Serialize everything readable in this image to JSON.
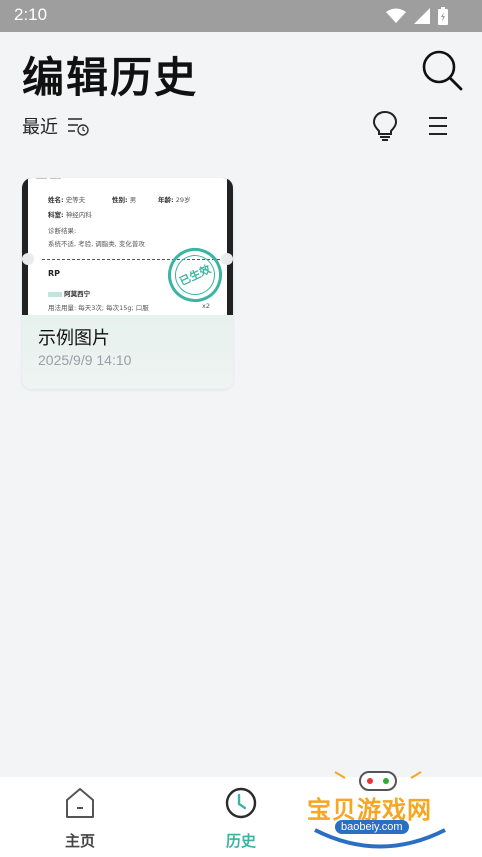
{
  "status_bar": {
    "time": "2:10",
    "icons": [
      "wifi-icon",
      "signal-icon",
      "battery-icon"
    ]
  },
  "header": {
    "title": "编辑历史"
  },
  "toolbar": {
    "sort_label": "最近"
  },
  "cards": [
    {
      "title": "示例图片",
      "time": "2025/9/9 14:10",
      "thumb": {
        "lines": [
          "姓名:",
          "史等夫",
          "性别:",
          "男",
          "年龄:",
          "29岁",
          "科室:",
          "神经内科",
          "诊断结果:",
          "系统不适, 考验, 调脂类, 变化普攻",
          "RP",
          "阿莫西宁",
          "用法用量: 每天3次; 每次15g; 口服",
          "x2"
        ],
        "stamp": "已生效"
      }
    }
  ],
  "bottom_nav": {
    "items": [
      {
        "label": "主页",
        "active": false
      },
      {
        "label": "历史",
        "active": true
      }
    ]
  },
  "watermark": {
    "text": "宝贝游戏网",
    "url": "baobeiy.com"
  },
  "colors": {
    "accent": "#3bb5a3",
    "status_bar": "#9e9e9e",
    "background": "#f3f4f6"
  }
}
